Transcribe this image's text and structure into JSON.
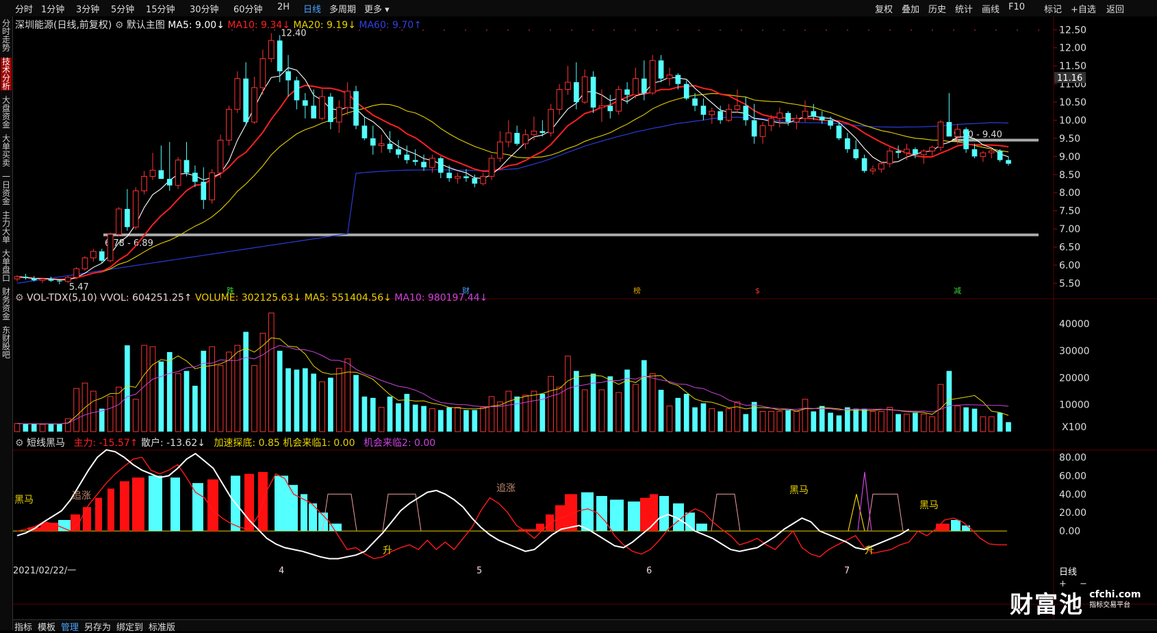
{
  "topbar": {
    "left_tabs": [
      "分时",
      "1分钟",
      "3分钟",
      "5分钟",
      "15分钟",
      "30分钟",
      "60分钟",
      "2H",
      "日线",
      "多周期",
      "更多 ▾"
    ],
    "active_tab": "日线",
    "right_tabs": [
      "复权",
      "叠加",
      "历史",
      "统计",
      "画线",
      "F10",
      "标记",
      "+自选",
      "返回"
    ]
  },
  "leftnav": [
    "分时走势",
    "技术分析",
    "大盘资金",
    "大单买卖",
    "一日资金",
    "主力大单",
    "大单盘口",
    "财务资金",
    "东财股吧"
  ],
  "main": {
    "stock": "深圳能源(日线,前复权)",
    "chart_name": "默认主图",
    "ma5": "MA5: 9.00↓",
    "ma10": "MA10: 9.34↓",
    "ma20": "MA20: 9.19↓",
    "ma60": "MA60: 9.70↑",
    "high_label": "12.40",
    "low_label": "5.47",
    "zone1": "6.78 - 6.89",
    "zone2": "9.50 - 9.40",
    "price_ticks": [
      "12.50",
      "12.00",
      "11.50",
      "11.00",
      "10.50",
      "10.00",
      "9.50",
      "9.00",
      "8.50",
      "8.00",
      "7.50",
      "7.00",
      "6.50",
      "6.00",
      "5.50"
    ],
    "current_price": "11.16",
    "event_markers": [
      "跌",
      "财",
      "榜",
      "$",
      "减"
    ]
  },
  "volume": {
    "name": "VOL-TDX(5,10)",
    "vvol": "VVOL: 604251.25↑",
    "volume": "VOLUME: 302125.63↓",
    "ma5": "MA5: 551404.56↓",
    "ma10": "MA10: 980197.44↓",
    "ticks": [
      "40000",
      "30000",
      "20000",
      "10000"
    ],
    "unit": "X100"
  },
  "indicator": {
    "name": "短线黑马",
    "zhuli": "主力: -15.57↑",
    "sanhu": "散户: -13.62↓",
    "jiasu": "加速探底: 0.85",
    "jihui1": "机会来临1: 0.00",
    "jihui2": "机会来临2: 0.00",
    "ticks": [
      "80.00",
      "60.00",
      "40.00",
      "20.00",
      "0.00"
    ],
    "labels": [
      "黑马",
      "追涨",
      "追涨",
      "黑马",
      "黑马",
      "升",
      "升"
    ]
  },
  "xaxis": {
    "date": "2021/02/22/一",
    "months": [
      "4",
      "5",
      "6",
      "7"
    ],
    "period": "日线"
  },
  "bottombar": [
    "指标",
    "模板",
    "管理",
    "另存为",
    "绑定到",
    "标准版"
  ],
  "bottombar_active": "管理",
  "watermark": {
    "brand": "财富池",
    "site": "cfchi.com",
    "tag": "指标交易平台"
  },
  "colors": {
    "up": "#ff3232",
    "down": "#54ffff",
    "ma5": "#ffffff",
    "ma10": "#ff2020",
    "ma20": "#e8d200",
    "ma60": "#2b3bd8",
    "volma10": "#cc44dd"
  },
  "chart_data": [
    {
      "type": "candlestick",
      "title": "深圳能源(日线,前复权)",
      "ylim": [
        5.3,
        12.6
      ],
      "x": [
        "2021/02/22",
        "4",
        "5",
        "6",
        "7"
      ],
      "ohlc": [
        [
          5.62,
          5.72,
          5.55,
          5.68
        ],
        [
          5.68,
          5.76,
          5.6,
          5.64
        ],
        [
          5.64,
          5.7,
          5.55,
          5.58
        ],
        [
          5.58,
          5.65,
          5.5,
          5.62
        ],
        [
          5.62,
          5.68,
          5.54,
          5.57
        ],
        [
          5.57,
          5.62,
          5.47,
          5.55
        ],
        [
          5.55,
          5.7,
          5.5,
          5.66
        ],
        [
          5.66,
          5.95,
          5.62,
          5.9
        ],
        [
          5.9,
          6.25,
          5.85,
          6.2
        ],
        [
          6.2,
          6.45,
          6.1,
          6.38
        ],
        [
          6.38,
          6.45,
          6.05,
          6.12
        ],
        [
          6.12,
          6.9,
          6.08,
          6.85
        ],
        [
          6.85,
          7.6,
          6.8,
          7.55
        ],
        [
          7.55,
          8.1,
          6.95,
          7.05
        ],
        [
          7.05,
          8.15,
          6.98,
          8.05
        ],
        [
          8.05,
          8.6,
          7.95,
          8.45
        ],
        [
          8.45,
          9.1,
          8.35,
          8.62
        ],
        [
          8.62,
          9.3,
          8.4,
          8.38
        ],
        [
          8.38,
          9.4,
          8.05,
          8.2
        ],
        [
          8.2,
          8.98,
          8.1,
          8.9
        ],
        [
          8.9,
          9.4,
          8.45,
          8.55
        ],
        [
          8.55,
          8.75,
          8.15,
          8.3
        ],
        [
          8.3,
          8.7,
          7.55,
          7.8
        ],
        [
          7.8,
          8.65,
          7.7,
          8.55
        ],
        [
          8.55,
          9.6,
          8.4,
          9.45
        ],
        [
          9.45,
          10.4,
          9.3,
          10.3
        ],
        [
          10.3,
          11.35,
          10.2,
          11.15
        ],
        [
          11.15,
          11.6,
          9.85,
          9.95
        ],
        [
          9.95,
          11.2,
          9.9,
          10.9
        ],
        [
          10.9,
          11.95,
          10.7,
          11.7
        ],
        [
          11.7,
          12.4,
          11.6,
          12.2
        ],
        [
          12.2,
          12.35,
          11.05,
          11.35
        ],
        [
          11.35,
          11.8,
          10.65,
          11.1
        ],
        [
          11.1,
          11.2,
          10.3,
          10.55
        ],
        [
          10.55,
          10.75,
          10.05,
          10.4
        ],
        [
          10.4,
          10.85,
          10.05,
          10.05
        ],
        [
          10.05,
          10.85,
          10.0,
          10.65
        ],
        [
          10.65,
          10.75,
          9.75,
          9.95
        ],
        [
          9.95,
          10.55,
          9.65,
          10.35
        ],
        [
          10.35,
          11.05,
          10.15,
          10.8
        ],
        [
          10.8,
          10.95,
          9.75,
          9.85
        ],
        [
          9.85,
          10.1,
          9.45,
          9.5
        ],
        [
          9.5,
          9.85,
          9.05,
          9.3
        ],
        [
          9.3,
          9.6,
          9.1,
          9.35
        ],
        [
          9.35,
          9.7,
          9.1,
          9.2
        ],
        [
          9.2,
          9.45,
          8.95,
          9.05
        ],
        [
          9.05,
          9.3,
          8.8,
          8.9
        ],
        [
          8.9,
          9.2,
          8.75,
          8.85
        ],
        [
          8.85,
          9.05,
          8.6,
          8.7
        ],
        [
          8.7,
          9.05,
          8.55,
          8.95
        ],
        [
          8.95,
          9.0,
          8.4,
          8.55
        ],
        [
          8.55,
          8.75,
          8.3,
          8.4
        ],
        [
          8.4,
          8.55,
          8.25,
          8.45
        ],
        [
          8.45,
          8.65,
          8.3,
          8.4
        ],
        [
          8.4,
          8.5,
          8.15,
          8.25
        ],
        [
          8.25,
          8.55,
          8.2,
          8.45
        ],
        [
          8.45,
          9.05,
          8.35,
          8.95
        ],
        [
          8.95,
          9.7,
          8.85,
          9.4
        ],
        [
          9.4,
          10.0,
          9.25,
          9.65
        ],
        [
          9.65,
          9.85,
          9.3,
          9.35
        ],
        [
          9.35,
          9.75,
          9.2,
          9.6
        ],
        [
          9.6,
          10.1,
          9.45,
          9.7
        ],
        [
          9.7,
          10.0,
          9.55,
          9.65
        ],
        [
          9.65,
          10.45,
          9.55,
          10.3
        ],
        [
          10.3,
          11.0,
          10.15,
          10.85
        ],
        [
          10.85,
          11.5,
          10.7,
          11.05
        ],
        [
          11.05,
          11.6,
          10.3,
          10.5
        ],
        [
          10.5,
          11.4,
          10.45,
          11.2
        ],
        [
          11.2,
          11.35,
          10.2,
          10.35
        ],
        [
          10.35,
          10.85,
          9.95,
          10.4
        ],
        [
          10.4,
          10.7,
          10.05,
          10.25
        ],
        [
          10.25,
          10.95,
          10.15,
          10.85
        ],
        [
          10.85,
          11.05,
          10.45,
          10.7
        ],
        [
          10.7,
          11.45,
          10.6,
          11.15
        ],
        [
          11.15,
          11.65,
          10.55,
          10.75
        ],
        [
          10.75,
          11.8,
          10.7,
          11.65
        ],
        [
          11.65,
          11.8,
          11.05,
          11.15
        ],
        [
          11.15,
          11.45,
          10.95,
          11.25
        ],
        [
          11.25,
          11.3,
          10.85,
          11.0
        ],
        [
          11.0,
          11.1,
          10.55,
          10.6
        ],
        [
          10.6,
          10.75,
          10.25,
          10.4
        ],
        [
          10.4,
          10.6,
          10.0,
          10.15
        ],
        [
          10.15,
          10.35,
          9.9,
          10.25
        ],
        [
          10.25,
          10.4,
          9.9,
          10.0
        ],
        [
          10.0,
          10.45,
          9.95,
          10.3
        ],
        [
          10.3,
          10.85,
          10.2,
          10.4
        ],
        [
          10.4,
          10.65,
          9.85,
          10.0
        ],
        [
          10.0,
          10.45,
          9.35,
          9.55
        ],
        [
          9.55,
          9.95,
          9.35,
          9.85
        ],
        [
          9.85,
          10.15,
          9.7,
          10.05
        ],
        [
          10.05,
          10.35,
          9.8,
          10.2
        ],
        [
          10.2,
          10.25,
          9.85,
          9.95
        ],
        [
          9.95,
          10.15,
          9.75,
          10.05
        ],
        [
          10.05,
          10.55,
          9.95,
          10.25
        ],
        [
          10.25,
          10.45,
          10.0,
          10.1
        ],
        [
          10.1,
          10.25,
          9.9,
          10.0
        ],
        [
          10.0,
          10.1,
          9.75,
          9.85
        ],
        [
          9.85,
          9.95,
          9.45,
          9.5
        ],
        [
          9.5,
          9.65,
          9.1,
          9.2
        ],
        [
          9.2,
          9.45,
          8.9,
          8.95
        ],
        [
          8.95,
          9.05,
          8.55,
          8.6
        ],
        [
          8.6,
          8.75,
          8.5,
          8.65
        ],
        [
          8.65,
          8.85,
          8.55,
          8.8
        ],
        [
          8.8,
          9.25,
          8.7,
          9.15
        ],
        [
          9.15,
          9.3,
          8.95,
          9.1
        ],
        [
          9.1,
          9.35,
          8.9,
          9.2
        ],
        [
          9.2,
          9.25,
          8.95,
          9.05
        ],
        [
          9.05,
          9.2,
          8.8,
          9.15
        ],
        [
          9.15,
          9.3,
          9.0,
          9.25
        ],
        [
          9.25,
          10.0,
          9.15,
          9.95
        ],
        [
          9.95,
          10.75,
          9.8,
          9.55
        ],
        [
          9.55,
          9.9,
          9.35,
          9.75
        ],
        [
          9.75,
          9.8,
          9.1,
          9.2
        ],
        [
          9.2,
          9.35,
          8.95,
          9.0
        ],
        [
          9.0,
          9.15,
          8.85,
          9.1
        ],
        [
          9.1,
          9.25,
          8.95,
          9.15
        ],
        [
          9.15,
          9.2,
          8.85,
          8.9
        ],
        [
          8.9,
          9.0,
          8.75,
          8.8
        ]
      ],
      "ma5": [],
      "ma10": [],
      "ma20": [],
      "ma60": []
    },
    {
      "type": "bar",
      "title": "VOL-TDX(5,10)",
      "ylim": [
        0,
        46000
      ],
      "values": [
        3000,
        2800,
        2900,
        2700,
        2800,
        2900,
        4800,
        16000,
        18000,
        15000,
        8500,
        13000,
        16500,
        32000,
        12000,
        32000,
        31500,
        26000,
        29500,
        21500,
        22500,
        17000,
        30000,
        31500,
        24500,
        29500,
        32000,
        37000,
        24500,
        36500,
        44000,
        30000,
        23500,
        23000,
        23500,
        21500,
        18500,
        20000,
        23500,
        27000,
        21000,
        13000,
        12500,
        9000,
        13000,
        10500,
        14000,
        10000,
        9500,
        8500,
        8000,
        9000,
        9000,
        8000,
        8000,
        9000,
        13000,
        11000,
        15000,
        13000,
        13500,
        15000,
        14000,
        20500,
        16500,
        28000,
        22500,
        15500,
        21500,
        15500,
        20500,
        14500,
        23000,
        17500,
        26500,
        21500,
        15500,
        9500,
        12500,
        14000,
        9000,
        10500,
        8500,
        7500,
        8500,
        11000,
        6500,
        11000,
        7500,
        7500,
        7500,
        8000,
        7500,
        12000,
        7500,
        9500,
        7000,
        6000,
        9000,
        8500,
        8500,
        7500,
        7500,
        9000,
        6500,
        6500,
        7000,
        6500,
        5500,
        17500,
        22500,
        9500,
        9000,
        8500,
        5500,
        5500,
        7000,
        3500
      ]
    },
    {
      "type": "line",
      "title": "短线黑马",
      "ylim": [
        -40,
        90
      ],
      "series": [
        {
          "name": "主力",
          "values": [
            0,
            2,
            5,
            10,
            8,
            4,
            0,
            10,
            28,
            40,
            52,
            62,
            70,
            78,
            80,
            66,
            62,
            66,
            72,
            58,
            42,
            36,
            22,
            14,
            8,
            4,
            2,
            16,
            44,
            62,
            57,
            40,
            35,
            30,
            20,
            10,
            -5,
            -20,
            -18,
            -25,
            -30,
            -28,
            -22,
            -18,
            -15,
            -20,
            -10,
            -20,
            -12,
            -20,
            -8,
            4,
            22,
            36,
            30,
            20,
            6,
            0,
            -8,
            2,
            10,
            14,
            18,
            22,
            24,
            20,
            10,
            -5,
            -15,
            -22,
            -25,
            -20,
            -10,
            2,
            10,
            18,
            24,
            20,
            10,
            2,
            -5,
            -15,
            -12,
            -8,
            -15,
            -20,
            -10,
            0,
            -18,
            -25,
            -28,
            -20,
            -15,
            -10,
            -5,
            -18,
            -24,
            -22,
            -20,
            -15,
            -12,
            0,
            -5,
            2,
            12,
            14,
            10,
            2,
            -8,
            -14,
            -15,
            -15
          ]
        },
        {
          "name": "散户",
          "values": [
            -5,
            -2,
            3,
            10,
            16,
            22,
            34,
            50,
            66,
            80,
            88,
            86,
            80,
            72,
            66,
            62,
            58,
            60,
            68,
            78,
            84,
            76,
            68,
            52,
            36,
            24,
            12,
            2,
            -8,
            -14,
            -18,
            -20,
            -22,
            -25,
            -28,
            -30,
            -30,
            -28,
            -26,
            -22,
            -12,
            -2,
            10,
            22,
            30,
            36,
            42,
            44,
            40,
            34,
            26,
            14,
            4,
            -4,
            -10,
            -14,
            -18,
            -22,
            -20,
            -12,
            -4,
            2,
            4,
            6,
            2,
            -4,
            -10,
            -16,
            -18,
            -12,
            -4,
            4,
            14,
            18,
            14,
            8,
            0,
            -4,
            -8,
            -14,
            -20,
            -22,
            -20,
            -18,
            -12,
            -6,
            2,
            8,
            14,
            10,
            0,
            -4,
            -8,
            -12,
            -18,
            -20,
            -16,
            -12,
            -8,
            -4,
            2
          ]
        }
      ]
    }
  ]
}
